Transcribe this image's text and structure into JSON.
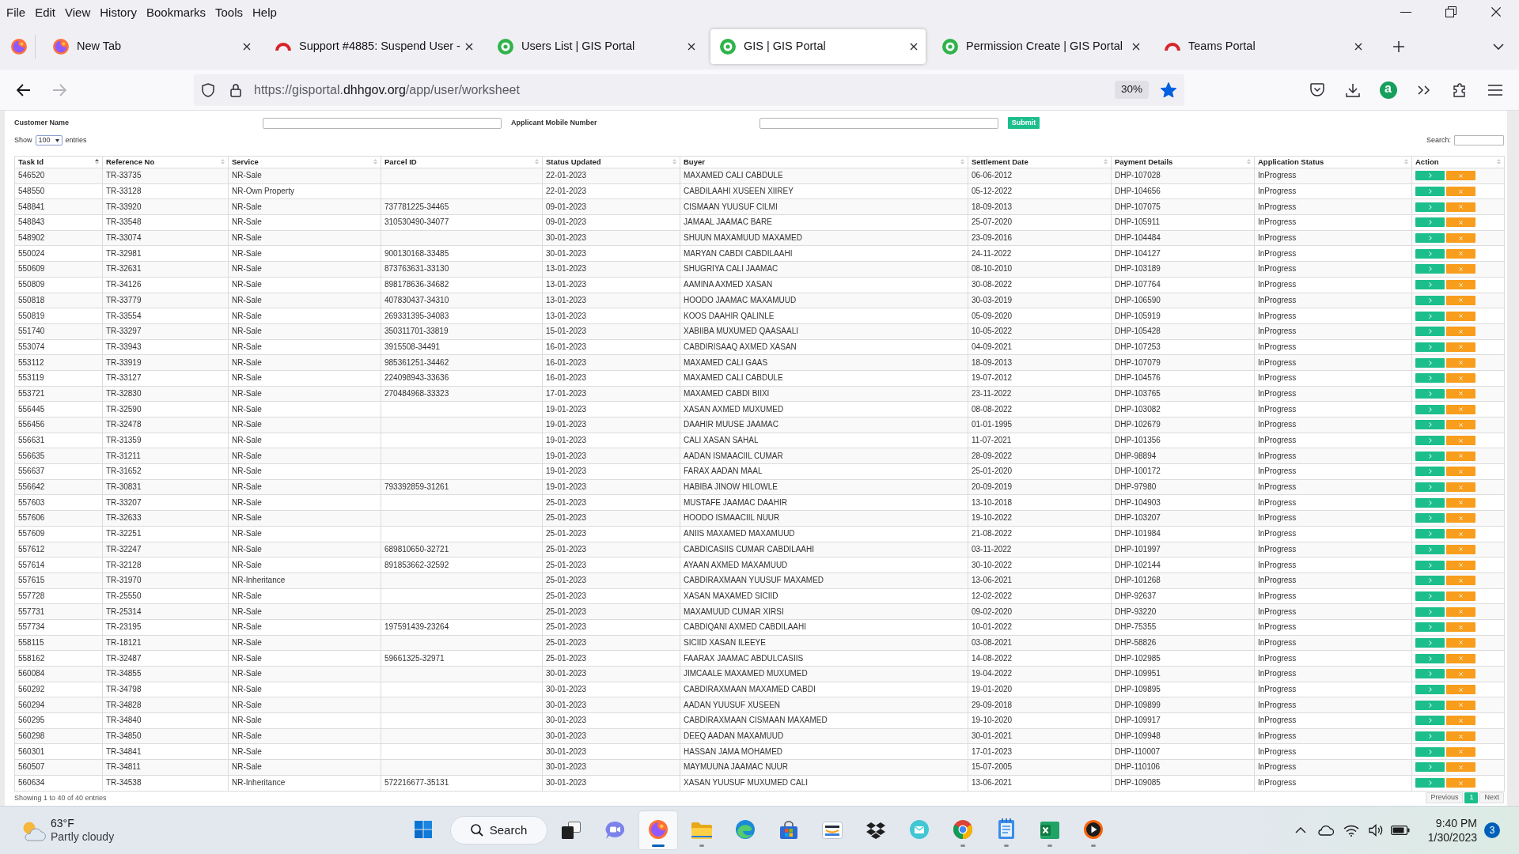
{
  "menu_bar": [
    "File",
    "Edit",
    "View",
    "History",
    "Bookmarks",
    "Tools",
    "Help"
  ],
  "tabs": [
    {
      "title": "New Tab",
      "kind": "firefox",
      "selected": false
    },
    {
      "title": "Support #4885: Suspend User -",
      "kind": "arc",
      "selected": false
    },
    {
      "title": "Users List | GIS Portal",
      "kind": "gis",
      "selected": false
    },
    {
      "title": "GIS | GIS Portal",
      "kind": "gis",
      "selected": true
    },
    {
      "title": "Permission Create | GIS Portal",
      "kind": "gis",
      "selected": false
    },
    {
      "title": "Teams Portal",
      "kind": "arc",
      "selected": false
    }
  ],
  "navigation": {
    "back_disabled": false,
    "forward_disabled": true
  },
  "address_bar": {
    "url": "https://gisportal.**dhhgov.org**/app/user/worksheet",
    "zoom": "30%",
    "bookmarked": true
  },
  "toolbar": {
    "extension_badge": "a"
  },
  "form": {
    "fields": [
      {
        "label": "Customer Name"
      },
      {
        "label": "Applicant Mobile Number"
      }
    ],
    "submit": "Submit"
  },
  "table_controls": {
    "show_label": "Show",
    "page_length": "100",
    "entries_label": "entries",
    "search_label": "Search:"
  },
  "table": {
    "columns": [
      {
        "label": "Task Id",
        "sorted": true
      },
      {
        "label": "Reference No",
        "sorted": false
      },
      {
        "label": "Service",
        "sorted": false
      },
      {
        "label": "Parcel ID",
        "sorted": false
      },
      {
        "label": "Status Updated",
        "sorted": false
      },
      {
        "label": "Buyer",
        "sorted": false
      },
      {
        "label": "Settlement Date",
        "sorted": false
      },
      {
        "label": "Payment Details",
        "sorted": false
      },
      {
        "label": "Application Status",
        "sorted": false
      },
      {
        "label": "Action",
        "sorted": false
      }
    ],
    "rows": [
      {
        "task_id": "546520",
        "reference_no": "TR-33735",
        "service": "NR-Sale",
        "status_updated": "22-01-2023",
        "buyer": "MAXAMED CALI CABDULE",
        "settlement_date": "06-06-2012",
        "payment_details": "DHP-107028",
        "application_status": "InProgress"
      },
      {
        "task_id": "548550",
        "reference_no": "TR-33128",
        "service": "NR-Own Property",
        "status_updated": "22-01-2023",
        "buyer": "CABDILAAHI XUSEEN XIIREY",
        "settlement_date": "05-12-2022",
        "payment_details": "DHP-104656",
        "application_status": "InProgress"
      },
      {
        "task_id": "548841",
        "reference_no": "TR-33920",
        "service": "NR-Sale",
        "parcel_id": "737781225-34465",
        "status_updated": "09-01-2023",
        "buyer": "CISMAAN YUUSUF CILMI",
        "settlement_date": "18-09-2013",
        "payment_details": "DHP-107075",
        "application_status": "InProgress"
      },
      {
        "task_id": "548843",
        "reference_no": "TR-33548",
        "service": "NR-Sale",
        "parcel_id": "310530490-34077",
        "status_updated": "09-01-2023",
        "buyer": "JAMAAL JAAMAC BARE",
        "settlement_date": "25-07-2020",
        "payment_details": "DHP-105911",
        "application_status": "InProgress"
      },
      {
        "task_id": "548902",
        "reference_no": "TR-33074",
        "service": "NR-Sale",
        "status_updated": "30-01-2023",
        "buyer": "SHUUN MAXAMUUD MAXAMED",
        "settlement_date": "23-09-2016",
        "payment_details": "DHP-104484",
        "application_status": "InProgress"
      },
      {
        "task_id": "550024",
        "reference_no": "TR-32981",
        "service": "NR-Sale",
        "parcel_id": "900130168-33485",
        "status_updated": "30-01-2023",
        "buyer": "MARYAN CABDI CABDILAAHI",
        "settlement_date": "24-11-2022",
        "payment_details": "DHP-104127",
        "application_status": "InProgress"
      },
      {
        "task_id": "550609",
        "reference_no": "TR-32631",
        "service": "NR-Sale",
        "parcel_id": "873763631-33130",
        "status_updated": "13-01-2023",
        "buyer": "SHUGRIYA CALI JAAMAC",
        "settlement_date": "08-10-2010",
        "payment_details": "DHP-103189",
        "application_status": "InProgress"
      },
      {
        "task_id": "550809",
        "reference_no": "TR-34126",
        "service": "NR-Sale",
        "parcel_id": "898178636-34682",
        "status_updated": "13-01-2023",
        "buyer": "AAMINA AXMED XASAN",
        "settlement_date": "30-08-2022",
        "payment_details": "DHP-107764",
        "application_status": "InProgress"
      },
      {
        "task_id": "550818",
        "reference_no": "TR-33779",
        "service": "NR-Sale",
        "parcel_id": "407830437-34310",
        "status_updated": "13-01-2023",
        "buyer": "HOODO JAAMAC MAXAMUUD",
        "settlement_date": "30-03-2019",
        "payment_details": "DHP-106590",
        "application_status": "InProgress"
      },
      {
        "task_id": "550819",
        "reference_no": "TR-33554",
        "service": "NR-Sale",
        "parcel_id": "269331395-34083",
        "status_updated": "13-01-2023",
        "buyer": "KOOS DAAHIR QALINLE",
        "settlement_date": "05-09-2020",
        "payment_details": "DHP-105919",
        "application_status": "InProgress"
      },
      {
        "task_id": "551740",
        "reference_no": "TR-33297",
        "service": "NR-Sale",
        "parcel_id": "350311701-33819",
        "status_updated": "15-01-2023",
        "buyer": "XABIIBA MUXUMED QAASAALI",
        "settlement_date": "10-05-2022",
        "payment_details": "DHP-105428",
        "application_status": "InProgress"
      },
      {
        "task_id": "553074",
        "reference_no": "TR-33943",
        "service": "NR-Sale",
        "parcel_id": "3915508-34491",
        "status_updated": "16-01-2023",
        "buyer": "CABDIRISAAQ AXMED XASAN",
        "settlement_date": "04-09-2021",
        "payment_details": "DHP-107253",
        "application_status": "InProgress"
      },
      {
        "task_id": "553112",
        "reference_no": "TR-33919",
        "service": "NR-Sale",
        "parcel_id": "985361251-34462",
        "status_updated": "16-01-2023",
        "buyer": "MAXAMED CALI GAAS",
        "settlement_date": "18-09-2013",
        "payment_details": "DHP-107079",
        "application_status": "InProgress"
      },
      {
        "task_id": "553119",
        "reference_no": "TR-33127",
        "service": "NR-Sale",
        "parcel_id": "224098943-33636",
        "status_updated": "16-01-2023",
        "buyer": "MAXAMED CALI CABDULE",
        "settlement_date": "19-07-2012",
        "payment_details": "DHP-104576",
        "application_status": "InProgress"
      },
      {
        "task_id": "553721",
        "reference_no": "TR-32830",
        "service": "NR-Sale",
        "parcel_id": "270484968-33323",
        "status_updated": "17-01-2023",
        "buyer": "MAXAMED CABDI BIIXI",
        "settlement_date": "23-11-2022",
        "payment_details": "DHP-103765",
        "application_status": "InProgress"
      },
      {
        "task_id": "556445",
        "reference_no": "TR-32590",
        "service": "NR-Sale",
        "status_updated": "19-01-2023",
        "buyer": "XASAN AXMED MUXUMED",
        "settlement_date": "08-08-2022",
        "payment_details": "DHP-103082",
        "application_status": "InProgress"
      },
      {
        "task_id": "556456",
        "reference_no": "TR-32478",
        "service": "NR-Sale",
        "status_updated": "19-01-2023",
        "buyer": "DAAHIR MUUSE JAAMAC",
        "settlement_date": "01-01-1995",
        "payment_details": "DHP-102679",
        "application_status": "InProgress"
      },
      {
        "task_id": "556631",
        "reference_no": "TR-31359",
        "service": "NR-Sale",
        "status_updated": "19-01-2023",
        "buyer": "CALI XASAN SAHAL",
        "settlement_date": "11-07-2021",
        "payment_details": "DHP-101356",
        "application_status": "InProgress"
      },
      {
        "task_id": "556635",
        "reference_no": "TR-31211",
        "service": "NR-Sale",
        "status_updated": "19-01-2023",
        "buyer": "AADAN ISMAACIIL CUMAR",
        "settlement_date": "28-09-2022",
        "payment_details": "DHP-98894",
        "application_status": "InProgress"
      },
      {
        "task_id": "556637",
        "reference_no": "TR-31652",
        "service": "NR-Sale",
        "status_updated": "19-01-2023",
        "buyer": "FARAX AADAN MAAL",
        "settlement_date": "25-01-2020",
        "payment_details": "DHP-100172",
        "application_status": "InProgress"
      },
      {
        "task_id": "556642",
        "reference_no": "TR-30831",
        "service": "NR-Sale",
        "parcel_id": "793392859-31261",
        "status_updated": "19-01-2023",
        "buyer": "HABIBA JINOW HILOWLE",
        "settlement_date": "20-09-2019",
        "payment_details": "DHP-97980",
        "application_status": "InProgress"
      },
      {
        "task_id": "557603",
        "reference_no": "TR-33207",
        "service": "NR-Sale",
        "status_updated": "25-01-2023",
        "buyer": "MUSTAFE JAAMAC DAAHIR",
        "settlement_date": "13-10-2018",
        "payment_details": "DHP-104903",
        "application_status": "InProgress"
      },
      {
        "task_id": "557606",
        "reference_no": "TR-32633",
        "service": "NR-Sale",
        "status_updated": "25-01-2023",
        "buyer": "HOODO ISMAACIIL NUUR",
        "settlement_date": "19-10-2022",
        "payment_details": "DHP-103207",
        "application_status": "InProgress"
      },
      {
        "task_id": "557609",
        "reference_no": "TR-32251",
        "service": "NR-Sale",
        "status_updated": "25-01-2023",
        "buyer": "ANIIS MAXAMED MAXAMUUD",
        "settlement_date": "21-08-2022",
        "payment_details": "DHP-101984",
        "application_status": "InProgress"
      },
      {
        "task_id": "557612",
        "reference_no": "TR-32247",
        "service": "NR-Sale",
        "parcel_id": "689810650-32721",
        "status_updated": "25-01-2023",
        "buyer": "CABDICASIIS CUMAR CABDILAAHI",
        "settlement_date": "03-11-2022",
        "payment_details": "DHP-101997",
        "application_status": "InProgress"
      },
      {
        "task_id": "557614",
        "reference_no": "TR-32128",
        "service": "NR-Sale",
        "parcel_id": "891853662-32592",
        "status_updated": "25-01-2023",
        "buyer": "AYAAN AXMED MAXAMUUD",
        "settlement_date": "30-10-2022",
        "payment_details": "DHP-102144",
        "application_status": "InProgress"
      },
      {
        "task_id": "557615",
        "reference_no": "TR-31970",
        "service": "NR-Inheritance",
        "status_updated": "25-01-2023",
        "buyer": "CABDIRAXMAAN YUUSUF MAXAMED",
        "settlement_date": "13-06-2021",
        "payment_details": "DHP-101268",
        "application_status": "InProgress"
      },
      {
        "task_id": "557728",
        "reference_no": "TR-25550",
        "service": "NR-Sale",
        "status_updated": "25-01-2023",
        "buyer": "XASAN MAXAMED SICIID",
        "settlement_date": "12-02-2022",
        "payment_details": "DHP-92637",
        "application_status": "InProgress"
      },
      {
        "task_id": "557731",
        "reference_no": "TR-25314",
        "service": "NR-Sale",
        "status_updated": "25-01-2023",
        "buyer": "MAXAMUUD CUMAR XIRSI",
        "settlement_date": "09-02-2020",
        "payment_details": "DHP-93220",
        "application_status": "InProgress"
      },
      {
        "task_id": "557734",
        "reference_no": "TR-23195",
        "service": "NR-Sale",
        "parcel_id": "197591439-23264",
        "status_updated": "25-01-2023",
        "buyer": "CABDIQANI AXMED CABDILAAHI",
        "settlement_date": "10-01-2022",
        "payment_details": "DHP-75355",
        "application_status": "InProgress"
      },
      {
        "task_id": "558115",
        "reference_no": "TR-18121",
        "service": "NR-Sale",
        "status_updated": "25-01-2023",
        "buyer": "SICIID XASAN ILEEYE",
        "settlement_date": "03-08-2021",
        "payment_details": "DHP-58826",
        "application_status": "InProgress"
      },
      {
        "task_id": "558162",
        "reference_no": "TR-32487",
        "service": "NR-Sale",
        "parcel_id": "59661325-32971",
        "status_updated": "25-01-2023",
        "buyer": "FAARAX JAAMAC ABDULCASIIS",
        "settlement_date": "14-08-2022",
        "payment_details": "DHP-102985",
        "application_status": "InProgress"
      },
      {
        "task_id": "560084",
        "reference_no": "TR-34855",
        "service": "NR-Sale",
        "status_updated": "30-01-2023",
        "buyer": "JIMCAALE MAXAMED MUXUMED",
        "settlement_date": "19-04-2022",
        "payment_details": "DHP-109951",
        "application_status": "InProgress"
      },
      {
        "task_id": "560292",
        "reference_no": "TR-34798",
        "service": "NR-Sale",
        "status_updated": "30-01-2023",
        "buyer": "CABDIRAXMAAN MAXAMED CABDI",
        "settlement_date": "19-01-2020",
        "payment_details": "DHP-109895",
        "application_status": "InProgress"
      },
      {
        "task_id": "560294",
        "reference_no": "TR-34828",
        "service": "NR-Sale",
        "status_updated": "30-01-2023",
        "buyer": "AADAN YUUSUF XUSEEN",
        "settlement_date": "29-09-2018",
        "payment_details": "DHP-109899",
        "application_status": "InProgress"
      },
      {
        "task_id": "560295",
        "reference_no": "TR-34840",
        "service": "NR-Sale",
        "status_updated": "30-01-2023",
        "buyer": "CABDIRAXMAAN CISMAAN MAXAMED",
        "settlement_date": "19-10-2020",
        "payment_details": "DHP-109917",
        "application_status": "InProgress"
      },
      {
        "task_id": "560298",
        "reference_no": "TR-34850",
        "service": "NR-Sale",
        "status_updated": "30-01-2023",
        "buyer": "DEEQ AADAN MAXAMUUD",
        "settlement_date": "30-01-2021",
        "payment_details": "DHP-109948",
        "application_status": "InProgress"
      },
      {
        "task_id": "560301",
        "reference_no": "TR-34841",
        "service": "NR-Sale",
        "status_updated": "30-01-2023",
        "buyer": "HASSAN JAMA MOHAMED",
        "settlement_date": "17-01-2023",
        "payment_details": "DHP-110007",
        "application_status": "InProgress"
      },
      {
        "task_id": "560507",
        "reference_no": "TR-34811",
        "service": "NR-Sale",
        "status_updated": "30-01-2023",
        "buyer": "MAYMUUNA JAAMAC NUUR",
        "settlement_date": "15-07-2005",
        "payment_details": "DHP-110106",
        "application_status": "InProgress"
      },
      {
        "task_id": "560634",
        "reference_no": "TR-34538",
        "service": "NR-Inheritance",
        "parcel_id": "572216677-35131",
        "status_updated": "30-01-2023",
        "buyer": "XASAN YUUSUF MUXUMED CALI",
        "settlement_date": "13-06-2021",
        "payment_details": "DHP-109085",
        "application_status": "InProgress"
      }
    ]
  },
  "footer": {
    "info": "Showing 1 to 40 of 40 entries",
    "pages": [
      {
        "label": "Previous",
        "selected": false
      },
      {
        "label": "1",
        "selected": true
      },
      {
        "label": "Next",
        "selected": false
      }
    ]
  },
  "taskbar": {
    "weather": {
      "temperature": "63°F",
      "condition": "Partly cloudy"
    },
    "search": "Search",
    "apps": [
      {
        "kind": "task_view",
        "running": false,
        "active": false
      },
      {
        "kind": "chat",
        "running": false,
        "active": false
      },
      {
        "kind": "firefox",
        "running": true,
        "active": true
      },
      {
        "kind": "explorer",
        "running": true,
        "active": false
      },
      {
        "kind": "edge",
        "running": false,
        "active": false
      },
      {
        "kind": "store",
        "running": false,
        "active": false
      },
      {
        "kind": "amazon",
        "running": false,
        "active": false
      },
      {
        "kind": "dropbox",
        "running": false,
        "active": false
      },
      {
        "kind": "mail",
        "running": false,
        "active": false
      },
      {
        "kind": "chrome",
        "running": true,
        "active": false
      },
      {
        "kind": "notepad",
        "running": true,
        "active": false
      },
      {
        "kind": "excel",
        "running": true,
        "active": false
      },
      {
        "kind": "player",
        "running": true,
        "active": false
      }
    ],
    "clock": {
      "time": "9:40 PM",
      "date": "1/30/2023"
    },
    "notifications": "3"
  }
}
